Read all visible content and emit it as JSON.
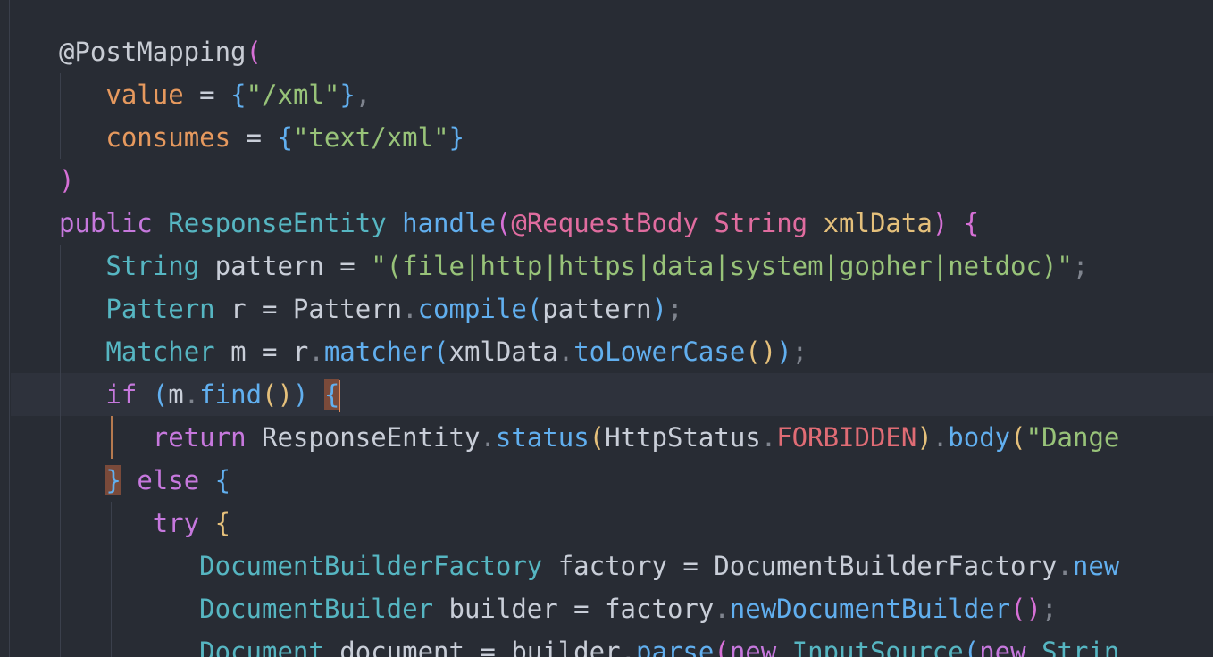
{
  "editor": {
    "lines": [
      {
        "tokens": [
          {
            "t": "@PostMapping",
            "c": "ann"
          },
          {
            "t": "(",
            "c": "br1"
          }
        ]
      },
      {
        "tokens": [
          {
            "t": "   ",
            "c": ""
          },
          {
            "t": "value",
            "c": "attr"
          },
          {
            "t": " = ",
            "c": "var"
          },
          {
            "t": "{",
            "c": "br2"
          },
          {
            "t": "\"/xml\"",
            "c": "str"
          },
          {
            "t": "}",
            "c": "br2"
          },
          {
            "t": ",",
            "c": "punc"
          }
        ]
      },
      {
        "tokens": [
          {
            "t": "   ",
            "c": ""
          },
          {
            "t": "consumes",
            "c": "attr"
          },
          {
            "t": " = ",
            "c": "var"
          },
          {
            "t": "{",
            "c": "br2"
          },
          {
            "t": "\"text/xml\"",
            "c": "str"
          },
          {
            "t": "}",
            "c": "br2"
          }
        ]
      },
      {
        "tokens": [
          {
            "t": ")",
            "c": "br1"
          }
        ]
      },
      {
        "tokens": [
          {
            "t": "public",
            "c": "kw"
          },
          {
            "t": " ",
            "c": ""
          },
          {
            "t": "ResponseEntity",
            "c": "ty"
          },
          {
            "t": " ",
            "c": ""
          },
          {
            "t": "handle",
            "c": "fn"
          },
          {
            "t": "(",
            "c": "br1"
          },
          {
            "t": "@RequestBody",
            "c": "anno2"
          },
          {
            "t": " ",
            "c": ""
          },
          {
            "t": "String",
            "c": "anno2"
          },
          {
            "t": " ",
            "c": ""
          },
          {
            "t": "xmlData",
            "c": "prm"
          },
          {
            "t": ")",
            "c": "br1"
          },
          {
            "t": " ",
            "c": ""
          },
          {
            "t": "{",
            "c": "br1"
          }
        ]
      },
      {
        "tokens": [
          {
            "t": "   ",
            "c": ""
          },
          {
            "t": "String",
            "c": "ty"
          },
          {
            "t": " pattern = ",
            "c": "var"
          },
          {
            "t": "\"(file|http|https|data|system|gopher|netdoc)\"",
            "c": "str"
          },
          {
            "t": ";",
            "c": "punc"
          }
        ]
      },
      {
        "tokens": [
          {
            "t": "   ",
            "c": ""
          },
          {
            "t": "Pattern",
            "c": "ty"
          },
          {
            "t": " r = Pattern",
            "c": "var"
          },
          {
            "t": ".",
            "c": "punc"
          },
          {
            "t": "compile",
            "c": "fn"
          },
          {
            "t": "(",
            "c": "br2"
          },
          {
            "t": "pattern",
            "c": "var"
          },
          {
            "t": ")",
            "c": "br2"
          },
          {
            "t": ";",
            "c": "punc"
          }
        ]
      },
      {
        "tokens": [
          {
            "t": "   ",
            "c": ""
          },
          {
            "t": "Matcher",
            "c": "ty"
          },
          {
            "t": " m = r",
            "c": "var"
          },
          {
            "t": ".",
            "c": "punc"
          },
          {
            "t": "matcher",
            "c": "fn"
          },
          {
            "t": "(",
            "c": "br2"
          },
          {
            "t": "xmlData",
            "c": "var"
          },
          {
            "t": ".",
            "c": "punc"
          },
          {
            "t": "toLowerCase",
            "c": "fn"
          },
          {
            "t": "()",
            "c": "br3"
          },
          {
            "t": ")",
            "c": "br2"
          },
          {
            "t": ";",
            "c": "punc"
          }
        ]
      },
      {
        "tokens": [
          {
            "t": "   ",
            "c": ""
          },
          {
            "t": "if",
            "c": "kw"
          },
          {
            "t": " ",
            "c": ""
          },
          {
            "t": "(",
            "c": "br2"
          },
          {
            "t": "m",
            "c": "var"
          },
          {
            "t": ".",
            "c": "punc"
          },
          {
            "t": "find",
            "c": "fn"
          },
          {
            "t": "()",
            "c": "br3"
          },
          {
            "t": ")",
            "c": "br2"
          },
          {
            "t": " ",
            "c": ""
          },
          {
            "t": "{",
            "c": "br2 match"
          },
          {
            "t": "",
            "c": "caret"
          }
        ]
      },
      {
        "tokens": [
          {
            "t": "      ",
            "c": ""
          },
          {
            "t": "return",
            "c": "kw"
          },
          {
            "t": " ResponseEntity",
            "c": "var"
          },
          {
            "t": ".",
            "c": "punc"
          },
          {
            "t": "status",
            "c": "fn"
          },
          {
            "t": "(",
            "c": "br3"
          },
          {
            "t": "HttpStatus",
            "c": "var"
          },
          {
            "t": ".",
            "c": "punc"
          },
          {
            "t": "FORBIDDEN",
            "c": "const"
          },
          {
            "t": ")",
            "c": "br3"
          },
          {
            "t": ".",
            "c": "punc"
          },
          {
            "t": "body",
            "c": "fn"
          },
          {
            "t": "(",
            "c": "br3"
          },
          {
            "t": "\"Dange",
            "c": "str"
          }
        ]
      },
      {
        "tokens": [
          {
            "t": "   ",
            "c": ""
          },
          {
            "t": "}",
            "c": "br2 match"
          },
          {
            "t": " ",
            "c": ""
          },
          {
            "t": "else",
            "c": "kw"
          },
          {
            "t": " ",
            "c": ""
          },
          {
            "t": "{",
            "c": "br2"
          }
        ]
      },
      {
        "tokens": [
          {
            "t": "      ",
            "c": ""
          },
          {
            "t": "try",
            "c": "kw"
          },
          {
            "t": " ",
            "c": ""
          },
          {
            "t": "{",
            "c": "br3"
          }
        ]
      },
      {
        "tokens": [
          {
            "t": "         ",
            "c": ""
          },
          {
            "t": "DocumentBuilderFactory",
            "c": "ty"
          },
          {
            "t": " factory = DocumentBuilderFactory",
            "c": "var"
          },
          {
            "t": ".",
            "c": "punc"
          },
          {
            "t": "new",
            "c": "fn"
          }
        ]
      },
      {
        "tokens": [
          {
            "t": "         ",
            "c": ""
          },
          {
            "t": "DocumentBuilder",
            "c": "ty"
          },
          {
            "t": " builder = factory",
            "c": "var"
          },
          {
            "t": ".",
            "c": "punc"
          },
          {
            "t": "newDocumentBuilder",
            "c": "fn"
          },
          {
            "t": "()",
            "c": "br1"
          },
          {
            "t": ";",
            "c": "punc"
          }
        ]
      },
      {
        "tokens": [
          {
            "t": "         ",
            "c": ""
          },
          {
            "t": "Document",
            "c": "ty"
          },
          {
            "t": " document = builder",
            "c": "var"
          },
          {
            "t": ".",
            "c": "punc"
          },
          {
            "t": "parse",
            "c": "fn"
          },
          {
            "t": "(",
            "c": "br1"
          },
          {
            "t": "new",
            "c": "kw"
          },
          {
            "t": " ",
            "c": ""
          },
          {
            "t": "InputSource",
            "c": "ty"
          },
          {
            "t": "(",
            "c": "br2"
          },
          {
            "t": "new",
            "c": "kw"
          },
          {
            "t": " ",
            "c": ""
          },
          {
            "t": "Strin",
            "c": "ty"
          }
        ]
      }
    ]
  }
}
